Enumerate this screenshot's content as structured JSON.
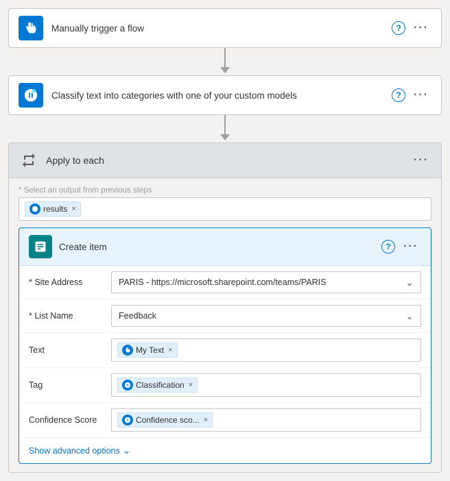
{
  "steps": [
    {
      "id": "trigger",
      "title": "Manually trigger a flow",
      "iconType": "hand",
      "iconBg": "#0078d4"
    },
    {
      "id": "classify",
      "title": "Classify text into categories with one of your custom models",
      "iconType": "brain",
      "iconBg": "#0078d4"
    }
  ],
  "applySection": {
    "title": "Apply to each",
    "selectLabel": "* Select an output from previous steps",
    "tag": "results"
  },
  "createItem": {
    "title": "Create item",
    "fields": [
      {
        "label": "* Site Address",
        "type": "dropdown",
        "value": "PARIS - https://microsoft.sharepoint.com/teams/PARIS"
      },
      {
        "label": "* List Name",
        "type": "dropdown",
        "value": "Feedback"
      },
      {
        "label": "Text",
        "type": "tag",
        "tags": [
          {
            "icon": "hand",
            "text": "My Text"
          }
        ]
      },
      {
        "label": "Tag",
        "type": "tag",
        "tags": [
          {
            "icon": "brain",
            "text": "Classification"
          }
        ]
      },
      {
        "label": "Confidence Score",
        "type": "tag",
        "tags": [
          {
            "icon": "brain",
            "text": "Confidence sco..."
          }
        ]
      }
    ],
    "showAdvanced": "Show advanced options"
  },
  "icons": {
    "help": "?",
    "dots": "···",
    "chevronDown": "⌄",
    "close": "×"
  }
}
